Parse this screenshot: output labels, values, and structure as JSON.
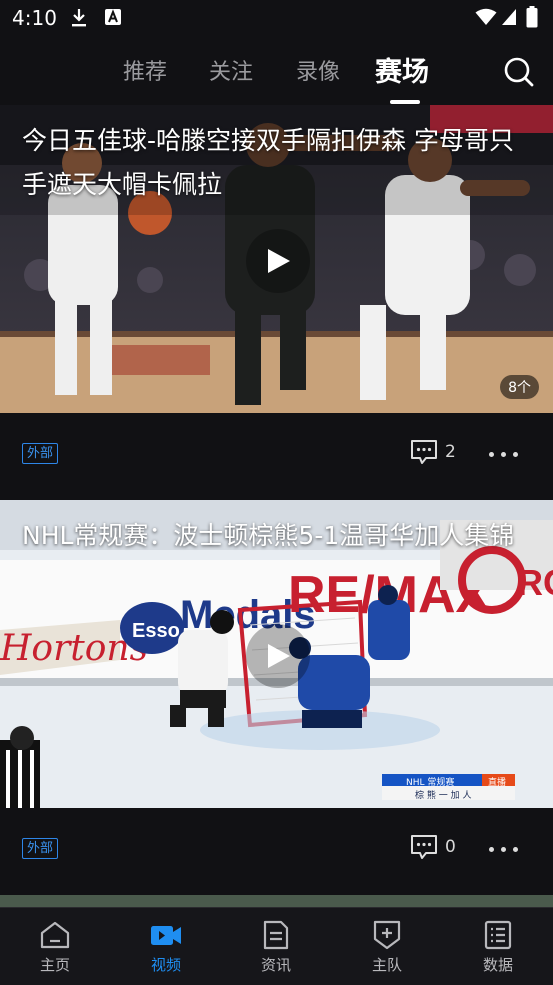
{
  "status_bar": {
    "time": "4:10"
  },
  "top_nav": {
    "tabs": [
      {
        "label": "推荐"
      },
      {
        "label": "关注"
      },
      {
        "label": "录像"
      },
      {
        "label": "赛场"
      }
    ],
    "active_tab": "赛场"
  },
  "feed": {
    "cards": [
      {
        "title": "今日五佳球-哈滕空接双手隔扣伊森 字母哥只手遮天大帽卡佩拉",
        "media_count": "8个",
        "tag": "外部",
        "comments": "2",
        "scene": "NBA game: Atlanta player in white/red jersey dribbling, Milwaukee player #34 in black defending",
        "scene_colors": {
          "court": "#c8a27a",
          "crowd": "#3a3a44",
          "jersey_away": "#f1f1f1",
          "jersey_home": "#1d1f1e"
        }
      },
      {
        "title": "NHL常规赛：波士顿棕熊5-1温哥华加人集锦",
        "scoreboard_line1": "NHL 常规赛",
        "scoreboard_live": "直播",
        "scoreboard_line2": "棕 熊 一 加 人",
        "tag": "外部",
        "comments": "0",
        "scene": "Hockey game near the net: Boston player in white/black, Vancouver players in blue",
        "scene_colors": {
          "ice": "#e8edf2",
          "boards": "#ffffff",
          "red_ad": "#c7202f",
          "blue_ad": "#1e3a8a"
        }
      }
    ]
  },
  "bottom_nav": {
    "items": [
      {
        "label": "主页",
        "icon": "home-icon"
      },
      {
        "label": "视频",
        "icon": "video-icon"
      },
      {
        "label": "资讯",
        "icon": "news-icon"
      },
      {
        "label": "主队",
        "icon": "team-icon"
      },
      {
        "label": "数据",
        "icon": "data-icon"
      }
    ],
    "active": "视频"
  },
  "colors": {
    "accent": "#1f8ef1",
    "background": "#111114",
    "tag": "#2e86e8"
  }
}
